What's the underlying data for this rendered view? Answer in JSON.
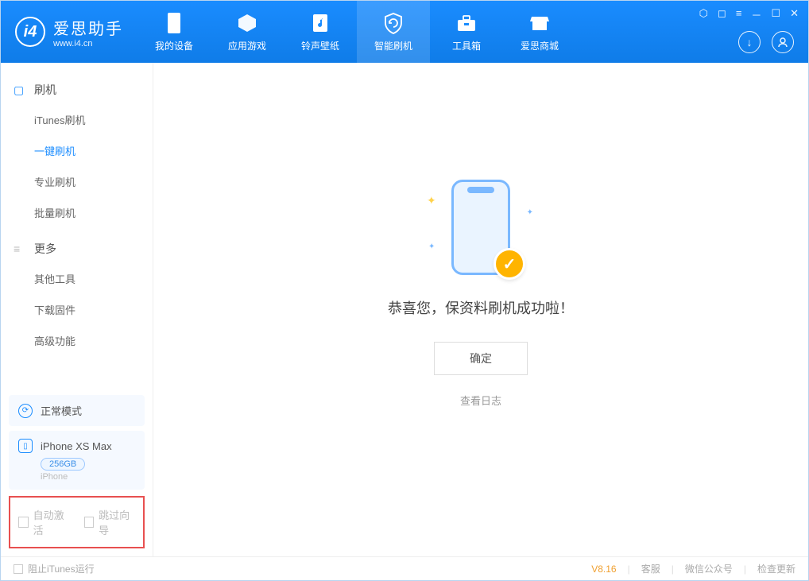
{
  "app": {
    "logo_title": "爱思助手",
    "logo_subtitle": "www.i4.cn"
  },
  "nav": {
    "tabs": [
      {
        "label": "我的设备",
        "icon": "phone"
      },
      {
        "label": "应用游戏",
        "icon": "cube"
      },
      {
        "label": "铃声壁纸",
        "icon": "music"
      },
      {
        "label": "智能刷机",
        "icon": "refresh",
        "active": true
      },
      {
        "label": "工具箱",
        "icon": "toolbox"
      },
      {
        "label": "爱思商城",
        "icon": "store"
      }
    ]
  },
  "sidebar": {
    "section1": {
      "title": "刷机",
      "items": [
        {
          "label": "iTunes刷机"
        },
        {
          "label": "一键刷机",
          "active": true
        },
        {
          "label": "专业刷机"
        },
        {
          "label": "批量刷机"
        }
      ]
    },
    "section2": {
      "title": "更多",
      "items": [
        {
          "label": "其他工具"
        },
        {
          "label": "下载固件"
        },
        {
          "label": "高级功能"
        }
      ]
    },
    "status": {
      "label": "正常模式"
    },
    "device": {
      "name": "iPhone XS Max",
      "storage": "256GB",
      "type": "iPhone"
    },
    "checks": {
      "auto_activate": "自动激活",
      "skip_guide": "跳过向导"
    }
  },
  "main": {
    "success_msg": "恭喜您，保资料刷机成功啦！",
    "ok_button": "确定",
    "log_link": "查看日志"
  },
  "footer": {
    "block_itunes": "阻止iTunes运行",
    "version": "V8.16",
    "links": {
      "service": "客服",
      "wechat": "微信公众号",
      "update": "检查更新"
    }
  }
}
